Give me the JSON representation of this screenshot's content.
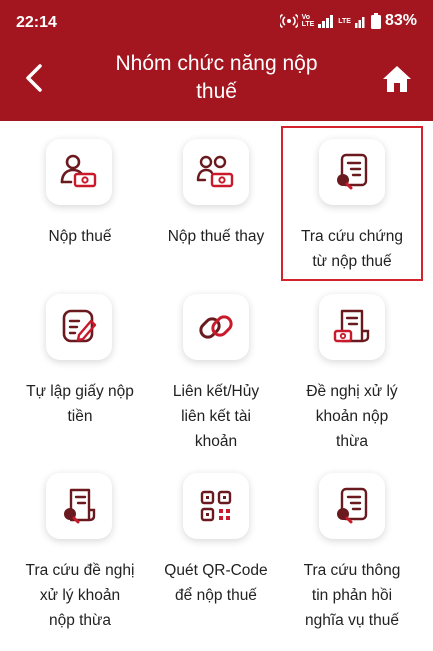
{
  "status_bar": {
    "time": "22:14",
    "volte_top": "Vo",
    "volte_bottom": "LTE",
    "lte_label": "LTE",
    "battery": "83%"
  },
  "header": {
    "title_line1": "Nhóm chức năng nộp",
    "title_line2": "thuế",
    "back_icon": "chevron-left-icon",
    "home_icon": "home-icon"
  },
  "colors": {
    "brand": "#a3161f",
    "icon_dark": "#6a1a1f",
    "icon_accent": "#c91a2b",
    "highlight_border": "#d5232e"
  },
  "items": [
    {
      "line1": "Nộp thuế",
      "line2": "",
      "line3": "",
      "icon": "person-money-icon"
    },
    {
      "line1": "Nộp thuế thay",
      "line2": "",
      "line3": "",
      "icon": "people-money-icon"
    },
    {
      "line1": "Tra cứu chứng",
      "line2": "từ nộp thuế",
      "line3": "",
      "icon": "document-search-icon"
    },
    {
      "line1": "Tự lập giấy nộp",
      "line2": "tiền",
      "line3": "",
      "icon": "edit-document-icon"
    },
    {
      "line1": "Liên kết/Hủy",
      "line2": "liên kết tài",
      "line3": "khoản",
      "icon": "link-icon"
    },
    {
      "line1": "Đề nghị xử lý",
      "line2": "khoản nộp",
      "line3": "thừa",
      "icon": "document-money-icon"
    },
    {
      "line1": "Tra cứu đề nghị",
      "line2": "xử lý khoản",
      "line3": "nộp thừa",
      "icon": "document-search-icon"
    },
    {
      "line1": "Quét QR-Code",
      "line2": "để nộp thuế",
      "line3": "",
      "icon": "qr-code-icon"
    },
    {
      "line1": "Tra cứu thông",
      "line2": "tin phản hồi",
      "line3": "nghĩa vụ thuế",
      "icon": "document-search-icon"
    }
  ]
}
